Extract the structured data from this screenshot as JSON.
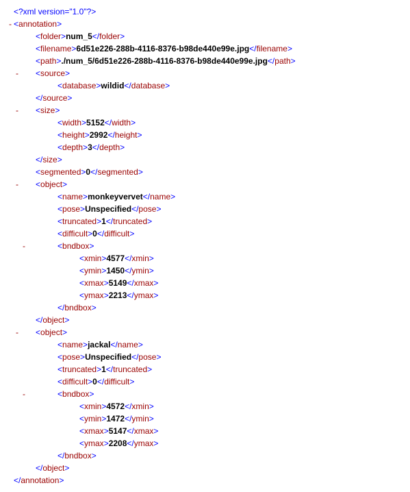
{
  "xml_decl": "<?xml version=\"1.0\"?>",
  "tags": {
    "annotation_open": "<annotation>",
    "annotation_close": "</annotation>",
    "folder_open": "<folder>",
    "folder_close": "</folder>",
    "filename_open": "<filename>",
    "filename_close": "</filename>",
    "path_open": "<path>",
    "path_close": "</path>",
    "source_open": "<source>",
    "source_close": "</source>",
    "database_open": "<database>",
    "database_close": "</database>",
    "size_open": "<size>",
    "size_close": "</size>",
    "width_open": "<width>",
    "width_close": "</width>",
    "height_open": "<height>",
    "height_close": "</height>",
    "depth_open": "<depth>",
    "depth_close": "</depth>",
    "segmented_open": "<segmented>",
    "segmented_close": "</segmented>",
    "object_open": "<object>",
    "object_close": "</object>",
    "name_open": "<name>",
    "name_close": "</name>",
    "pose_open": "<pose>",
    "pose_close": "</pose>",
    "truncated_open": "<truncated>",
    "truncated_close": "</truncated>",
    "difficult_open": "<difficult>",
    "difficult_close": "</difficult>",
    "bndbox_open": "<bndbox>",
    "bndbox_close": "</bndbox>",
    "xmin_open": "<xmin>",
    "xmin_close": "</xmin>",
    "ymin_open": "<ymin>",
    "ymin_close": "</ymin>",
    "xmax_open": "<xmax>",
    "xmax_close": "</xmax>",
    "ymax_open": "<ymax>",
    "ymax_close": "</ymax>"
  },
  "values": {
    "folder": "num_5",
    "filename": "6d51e226-288b-4116-8376-b98de440e99e.jpg",
    "path": "./num_5/6d51e226-288b-4116-8376-b98de440e99e.jpg",
    "database": "wildid",
    "width": "5152",
    "height": "2992",
    "depth": "3",
    "segmented": "0",
    "obj1": {
      "name": "monkeyvervet",
      "pose": "Unspecified",
      "truncated": "1",
      "difficult": "0",
      "xmin": "4577",
      "ymin": "1450",
      "xmax": "5149",
      "ymax": "2213"
    },
    "obj2": {
      "name": "jackal",
      "pose": "Unspecified",
      "truncated": "1",
      "difficult": "0",
      "xmin": "4572",
      "ymin": "1472",
      "xmax": "5147",
      "ymax": "2208"
    }
  },
  "dash": "-"
}
